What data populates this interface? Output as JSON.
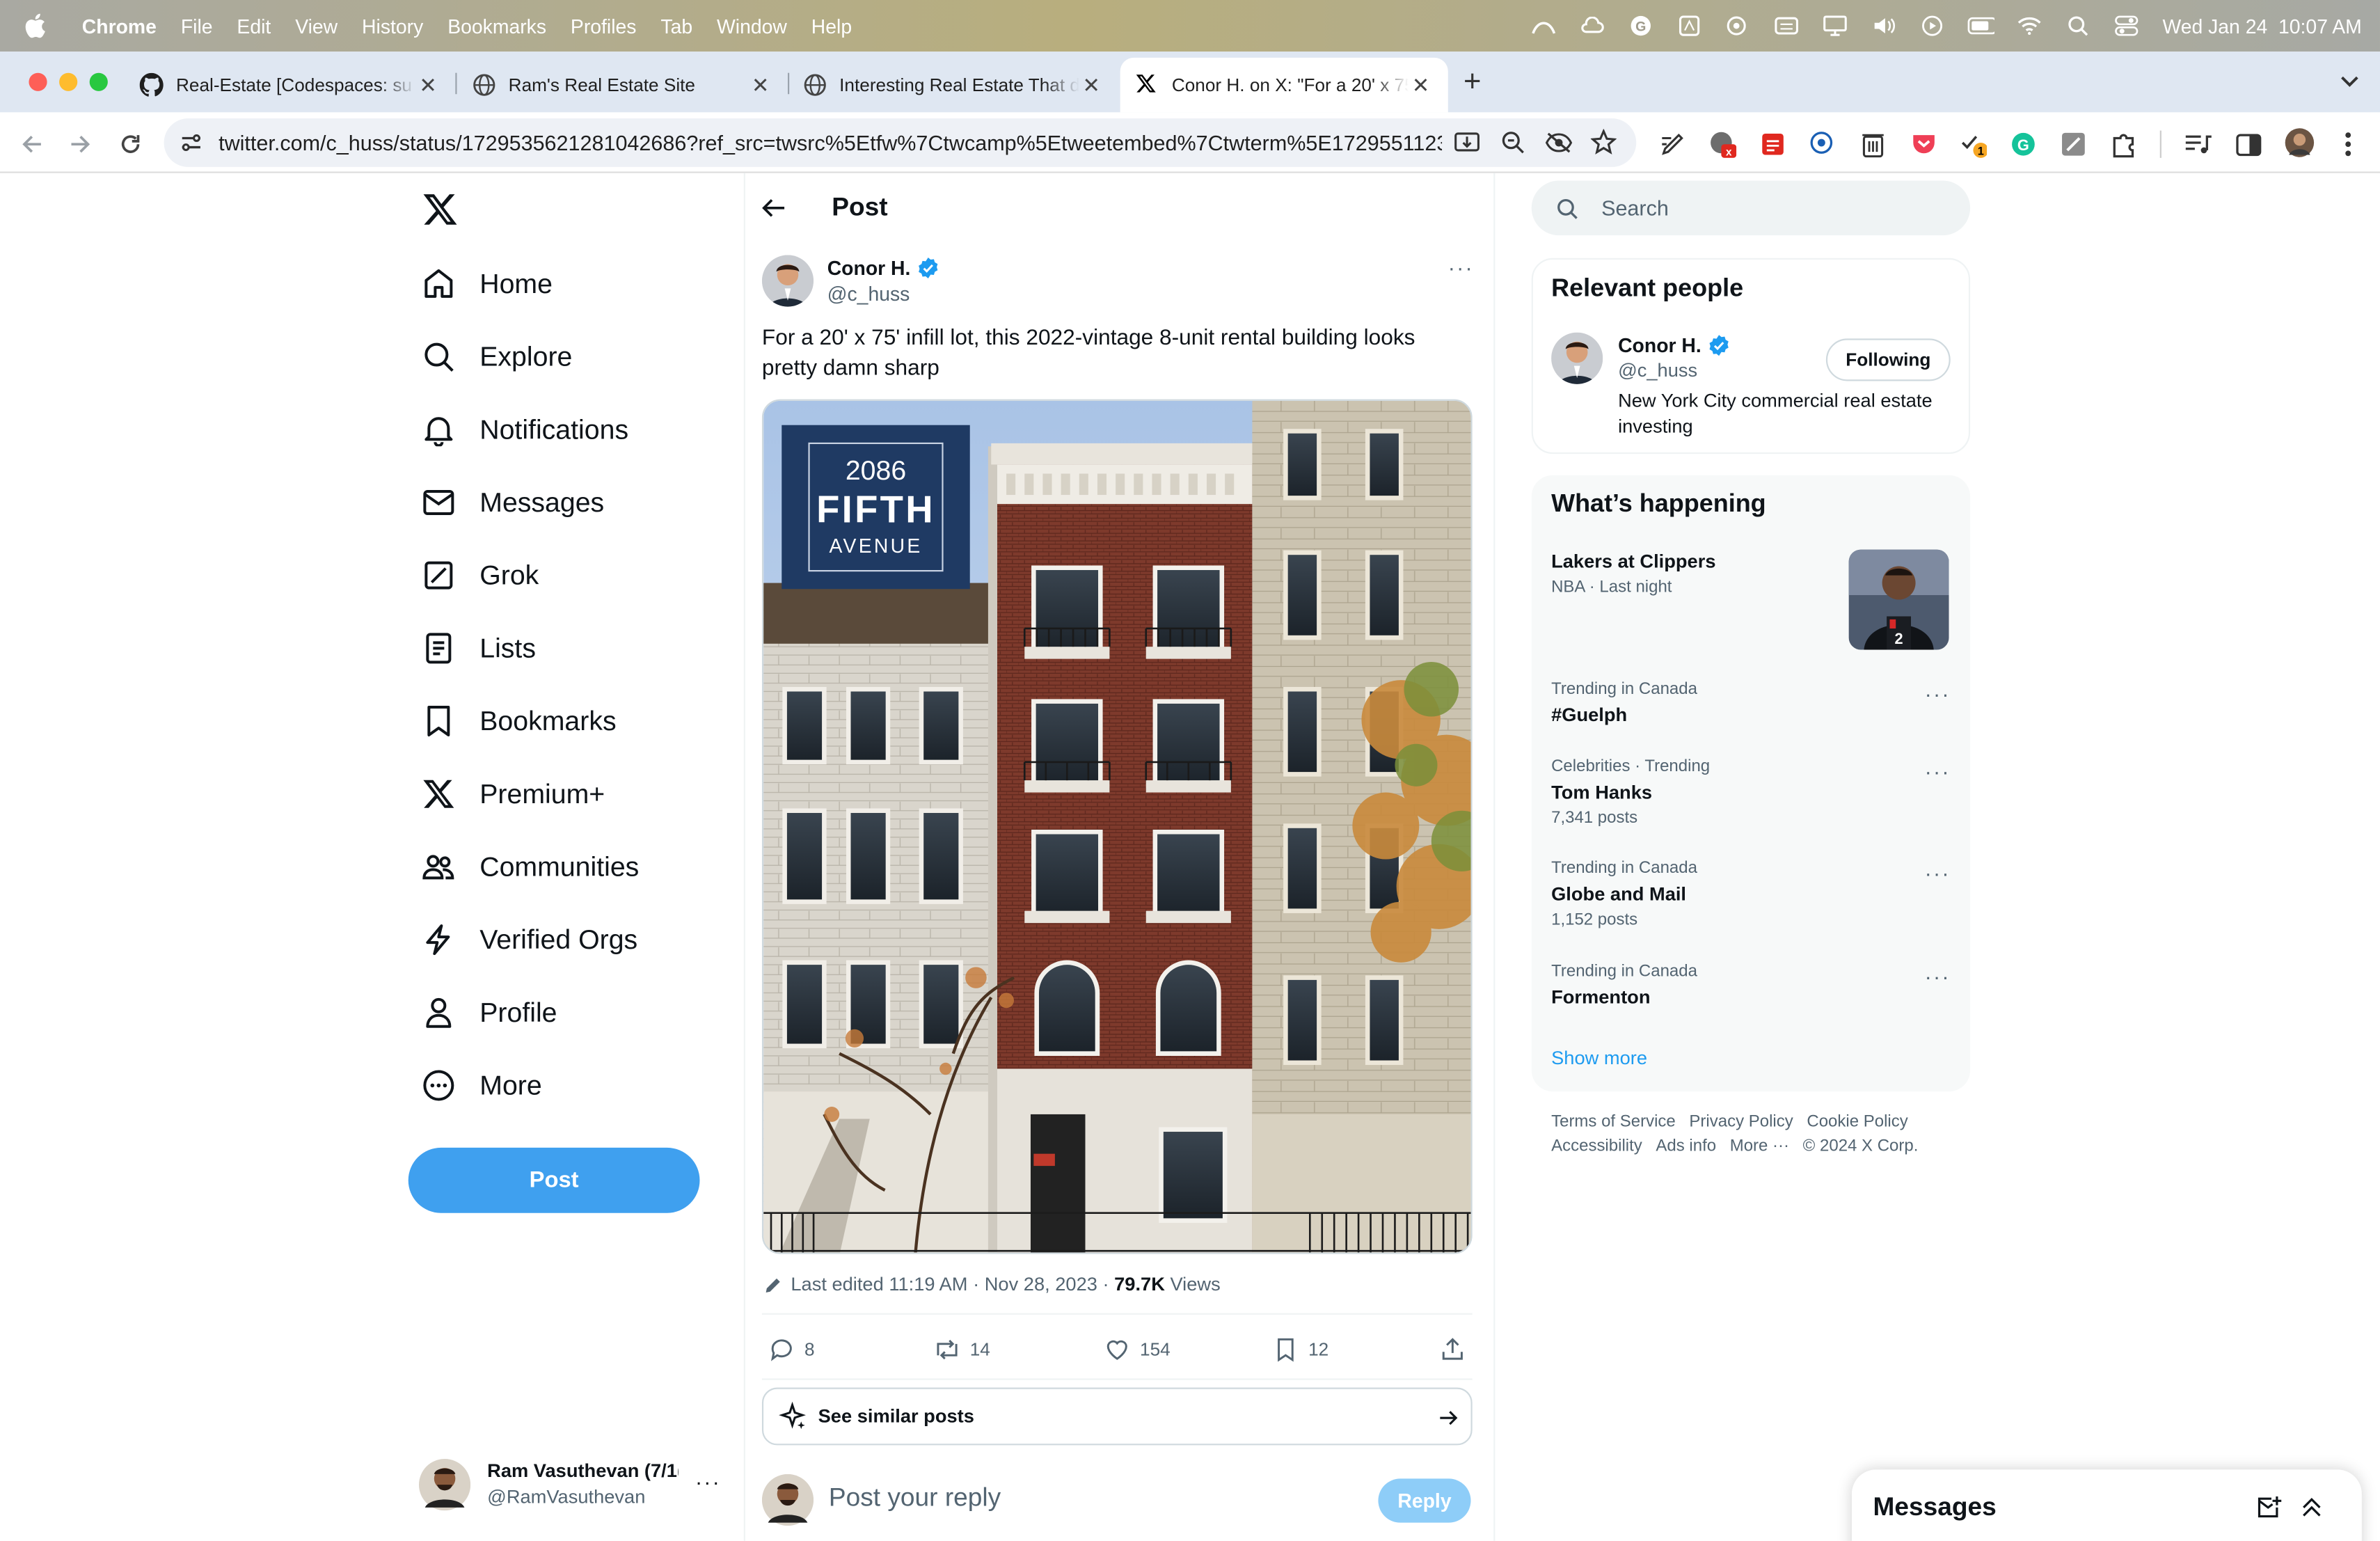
{
  "menubar": {
    "app": "Chrome",
    "items": [
      "File",
      "Edit",
      "View",
      "History",
      "Bookmarks",
      "Profiles",
      "Tab",
      "Window",
      "Help"
    ],
    "datetime": "Wed Jan 24  10:07 AM"
  },
  "tabs": [
    {
      "title": "Real-Estate [Codespaces: su",
      "icon": "github-icon"
    },
    {
      "title": "Ram's Real Estate Site",
      "icon": "globe-icon"
    },
    {
      "title": "Interesting Real Estate That d",
      "icon": "globe-icon"
    },
    {
      "title": "Conor H. on X: \"For a 20' x 75",
      "icon": "x-logo-icon",
      "active": true
    }
  ],
  "address": {
    "url": "twitter.com/c_huss/status/1729535621281042686?ref_src=twsrc%5Etfw%7Ctwcamp%5Etweetembed%7Ctwterm%5E1729551123..."
  },
  "extensions": {
    "badge_red": "x",
    "badge_yellow": "1"
  },
  "nav": {
    "items": [
      {
        "label": "Home",
        "icon": "home-icon"
      },
      {
        "label": "Explore",
        "icon": "search-icon"
      },
      {
        "label": "Notifications",
        "icon": "bell-icon"
      },
      {
        "label": "Messages",
        "icon": "envelope-icon"
      },
      {
        "label": "Grok",
        "icon": "grok-icon"
      },
      {
        "label": "Lists",
        "icon": "list-icon"
      },
      {
        "label": "Bookmarks",
        "icon": "bookmark-icon"
      },
      {
        "label": "Premium+",
        "icon": "x-logo-icon"
      },
      {
        "label": "Communities",
        "icon": "people-icon"
      },
      {
        "label": "Verified Orgs",
        "icon": "lightning-icon"
      },
      {
        "label": "Profile",
        "icon": "person-icon"
      },
      {
        "label": "More",
        "icon": "more-circle-icon"
      }
    ],
    "post_label": "Post",
    "account_name": "Ram Vasuthevan (7/1(",
    "account_handle": "@RamVasuthevan"
  },
  "post": {
    "header": "Post",
    "author_name": "Conor H.",
    "author_handle": "@c_huss",
    "text": "For a 20' x 75' infill lot, this 2022-vintage 8-unit rental building looks pretty damn sharp",
    "image_sign": {
      "line1": "2086",
      "line2": "FIFTH",
      "line3": "AVENUE"
    },
    "edited": "Last edited 11:19 AM · Nov 28, 2023 · ",
    "views_count": "79.7K",
    "views_label": " Views",
    "stats": {
      "replies": "8",
      "reposts": "14",
      "likes": "154",
      "bookmarks": "12"
    },
    "similar_label": "See similar posts",
    "reply_placeholder": "Post your reply",
    "reply_button": "Reply"
  },
  "sidebar": {
    "search_placeholder": "Search",
    "relevant_title": "Relevant people",
    "person": {
      "name": "Conor H.",
      "handle": "@c_huss",
      "follow_label": "Following",
      "bio": "New York City commercial real estate investing"
    },
    "happening_title": "What’s happening",
    "event": {
      "title": "Lakers at Clippers",
      "meta": "NBA · Last night"
    },
    "trends": [
      {
        "context": "Trending in Canada",
        "title": "#Guelph",
        "posts": ""
      },
      {
        "context": "Celebrities · Trending",
        "title": "Tom Hanks",
        "posts": "7,341 posts"
      },
      {
        "context": "Trending in Canada",
        "title": "Globe and Mail",
        "posts": "1,152 posts"
      },
      {
        "context": "Trending in Canada",
        "title": "Formenton",
        "posts": ""
      }
    ],
    "show_more": "Show more",
    "footer": [
      "Terms of Service",
      "Privacy Policy",
      "Cookie Policy",
      "Accessibility",
      "Ads info",
      "More ···",
      "© 2024 X Corp."
    ]
  },
  "messages_drawer": {
    "title": "Messages"
  },
  "colors": {
    "accent": "#1d9bf0",
    "post_button": "#3fa0ef",
    "reply_disabled": "#8ecdf8"
  }
}
